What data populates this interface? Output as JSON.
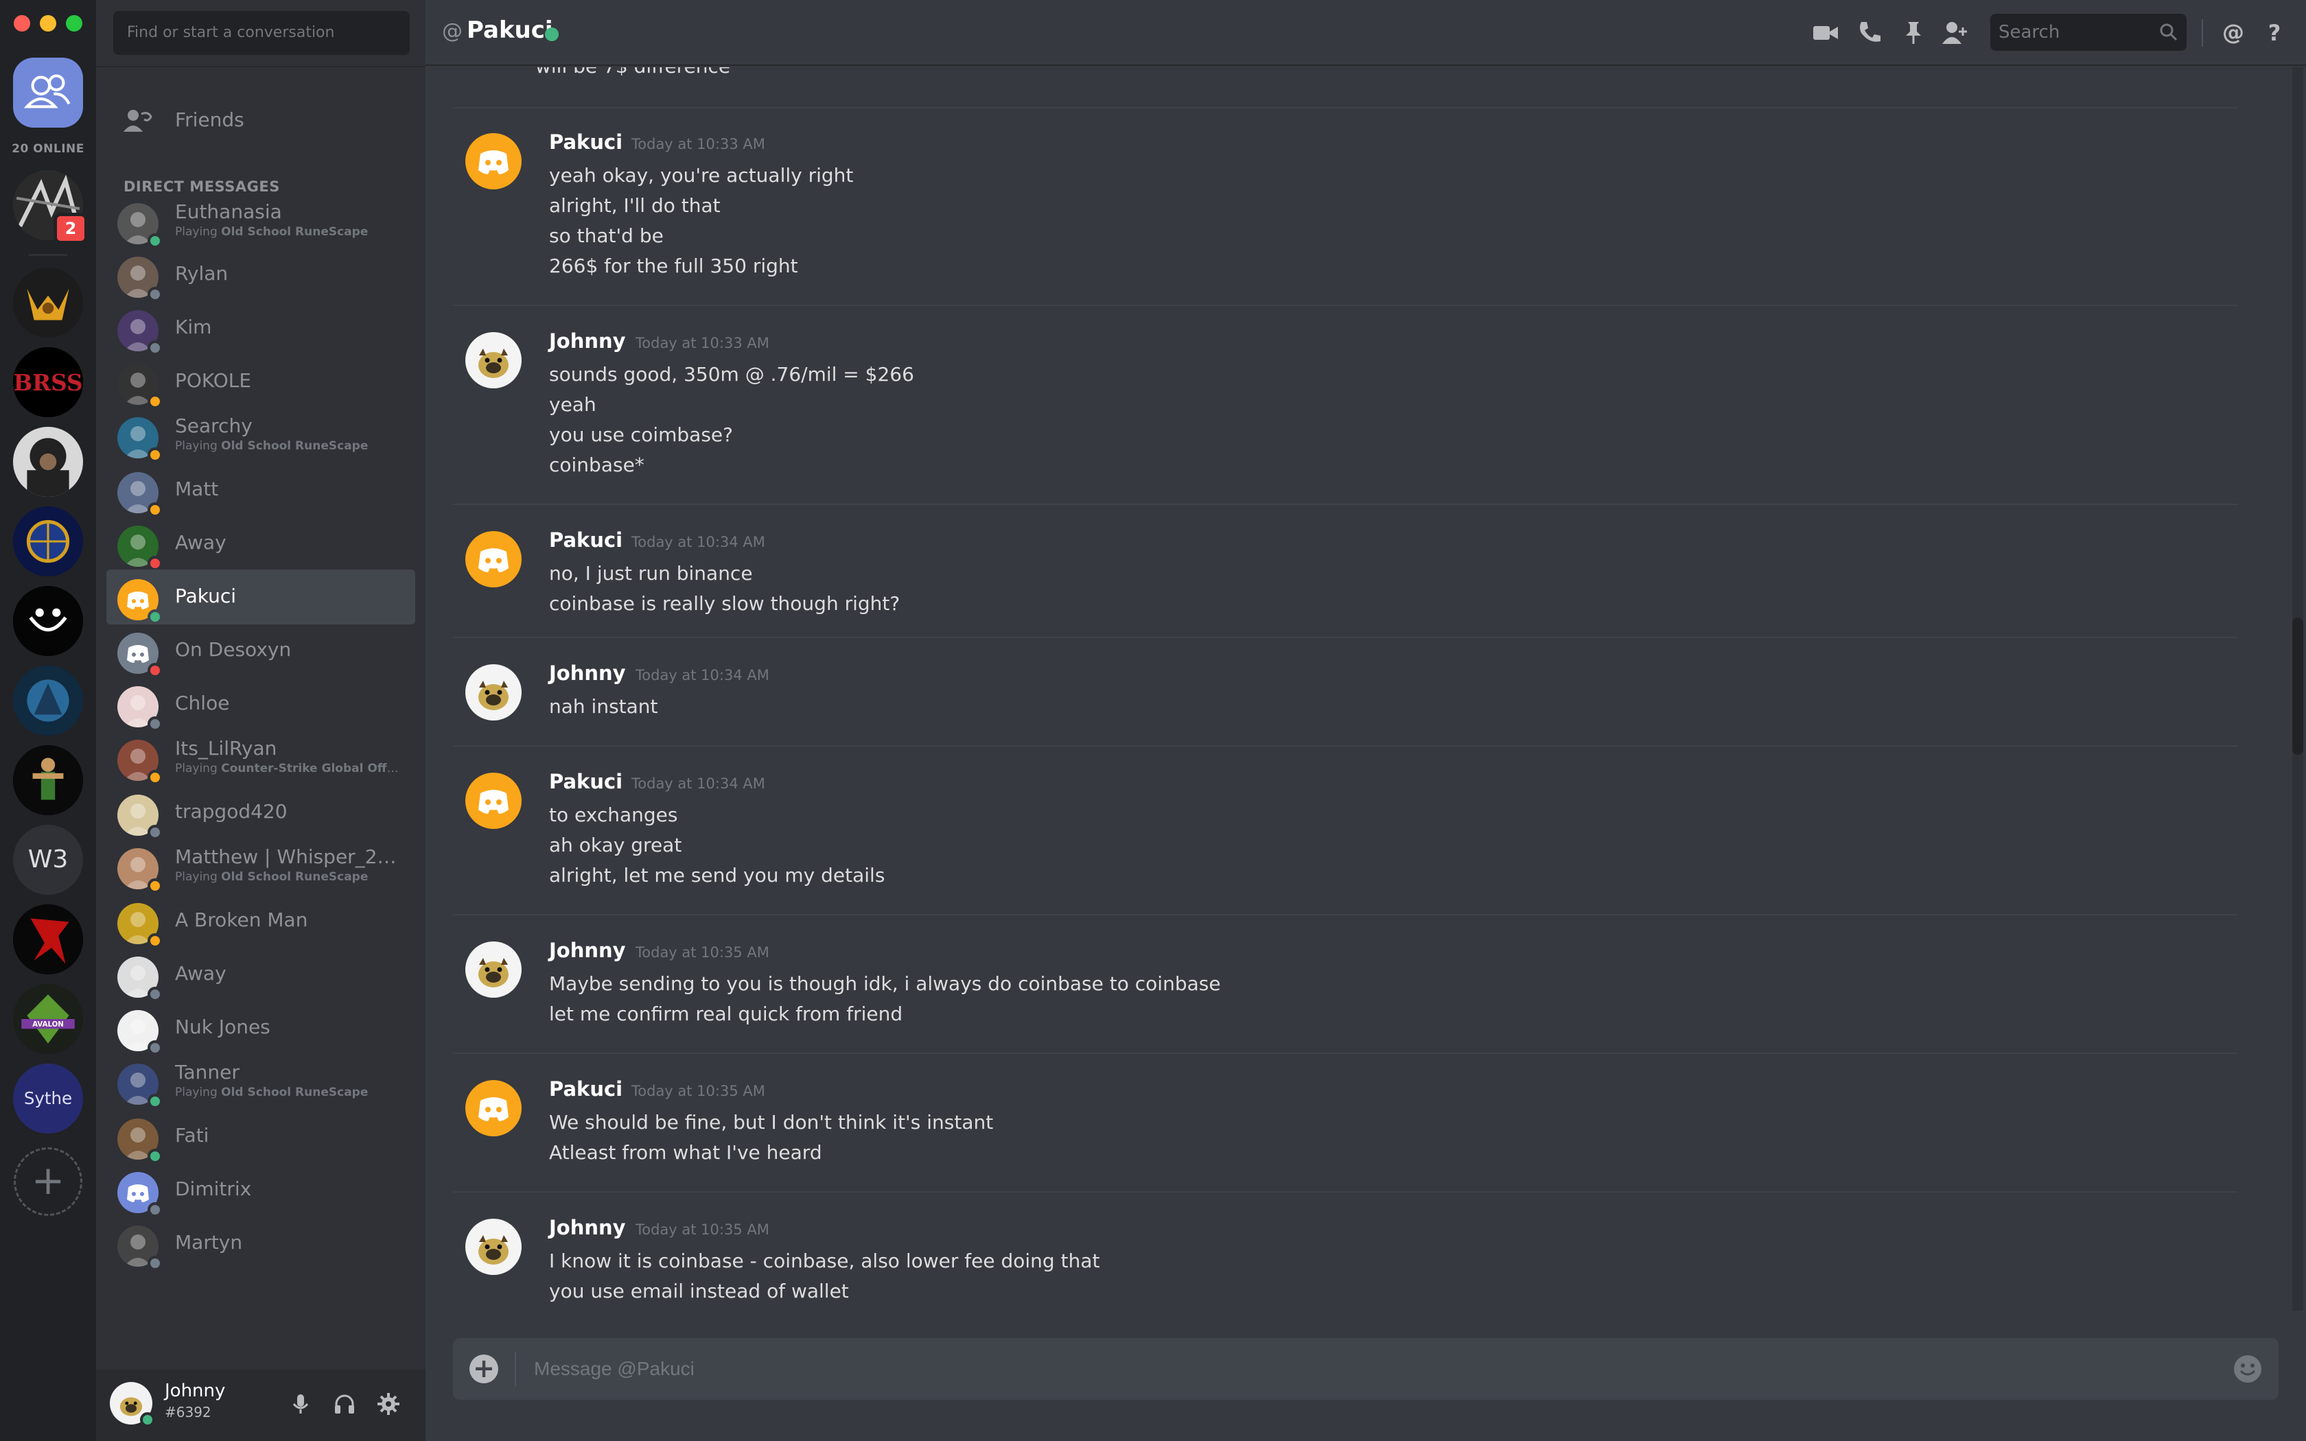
{
  "rail": {
    "online_count": "20 ONLINE",
    "badge_count": "2",
    "w3_label": "W3"
  },
  "sidebar": {
    "search_placeholder": "Find or start a conversation",
    "friends_label": "Friends",
    "dm_header": "DIRECT MESSAGES",
    "dms": [
      {
        "name": "Euthanasia",
        "sub_prefix": "Playing",
        "sub_game": "Old School RuneScape",
        "status": "online"
      },
      {
        "name": "Rylan",
        "status": "offline"
      },
      {
        "name": "Kim",
        "status": "offline"
      },
      {
        "name": "POKOLE",
        "status": "idle"
      },
      {
        "name": "Searchy",
        "sub_prefix": "Playing",
        "sub_game": "Old School RuneScape",
        "status": "idle"
      },
      {
        "name": "Matt",
        "status": "idle"
      },
      {
        "name": "Away",
        "status": "dnd"
      },
      {
        "name": "Pakuci",
        "status": "online"
      },
      {
        "name": "On Desoxyn",
        "status": "dnd"
      },
      {
        "name": "Chloe",
        "status": "offline"
      },
      {
        "name": "Its_LilRyan",
        "sub_prefix": "Playing",
        "sub_game": "Counter-Strike Global Offen...",
        "status": "idle"
      },
      {
        "name": "trapgod420",
        "status": "offline"
      },
      {
        "name": "Matthew | Whisper_2_...",
        "sub_prefix": "Playing",
        "sub_game": "Old School RuneScape",
        "status": "idle"
      },
      {
        "name": "A Broken Man",
        "status": "idle"
      },
      {
        "name": "Away",
        "status": "offline"
      },
      {
        "name": "Nuk Jones",
        "status": "offline"
      },
      {
        "name": "Tanner",
        "sub_prefix": "Playing",
        "sub_game": "Old School RuneScape",
        "status": "online"
      },
      {
        "name": "Fati",
        "status": "online"
      },
      {
        "name": "Dimitrix",
        "status": "offline"
      },
      {
        "name": "Martyn",
        "status": "offline"
      }
    ],
    "user": {
      "name": "Johnny",
      "tag": "#6392"
    }
  },
  "header": {
    "at_symbol": "@",
    "channel": "Pakuci",
    "search_placeholder": "Search"
  },
  "chat": {
    "top_fragment": "will be 7$ difference",
    "messages": [
      {
        "author": "Pakuci",
        "time": "Today at 10:33 AM",
        "avatar": "discord",
        "lines": [
          "yeah okay, you're actually right",
          "alright, I'll do that",
          "so that'd be",
          "266$ for the full 350 right"
        ]
      },
      {
        "author": "Johnny",
        "time": "Today at 10:33 AM",
        "avatar": "johnny",
        "lines": [
          "sounds good, 350m @ .76/mil = $266",
          "yeah",
          "you use coimbase?",
          "coinbase*"
        ]
      },
      {
        "author": "Pakuci",
        "time": "Today at 10:34 AM",
        "avatar": "discord",
        "lines": [
          "no, I just run binance",
          "coinbase is really slow though right?"
        ]
      },
      {
        "author": "Johnny",
        "time": "Today at 10:34 AM",
        "avatar": "johnny",
        "lines": [
          "nah instant"
        ]
      },
      {
        "author": "Pakuci",
        "time": "Today at 10:34 AM",
        "avatar": "discord",
        "lines": [
          "to exchanges",
          "ah okay great",
          "alright, let me send you my details"
        ]
      },
      {
        "author": "Johnny",
        "time": "Today at 10:35 AM",
        "avatar": "johnny",
        "lines": [
          "Maybe sending to you is though idk, i always do coinbase to coinbase",
          "let me confirm real quick from friend"
        ]
      },
      {
        "author": "Pakuci",
        "time": "Today at 10:35 AM",
        "avatar": "discord",
        "lines": [
          "We should be fine, but I don't think it's instant",
          "Atleast from what I've heard"
        ]
      },
      {
        "author": "Johnny",
        "time": "Today at 10:35 AM",
        "avatar": "johnny",
        "lines": [
          "I know it is coinbase - coinbase, also lower fee doing that",
          "you use email instead of wallet"
        ]
      }
    ],
    "composer_placeholder": "Message @Pakuci"
  },
  "colors": {
    "online": "#43b581",
    "idle": "#faa61a",
    "dnd": "#f04747",
    "offline": "#747f8d",
    "discord_orange": "#faa61a",
    "blurple": "#7289da"
  }
}
